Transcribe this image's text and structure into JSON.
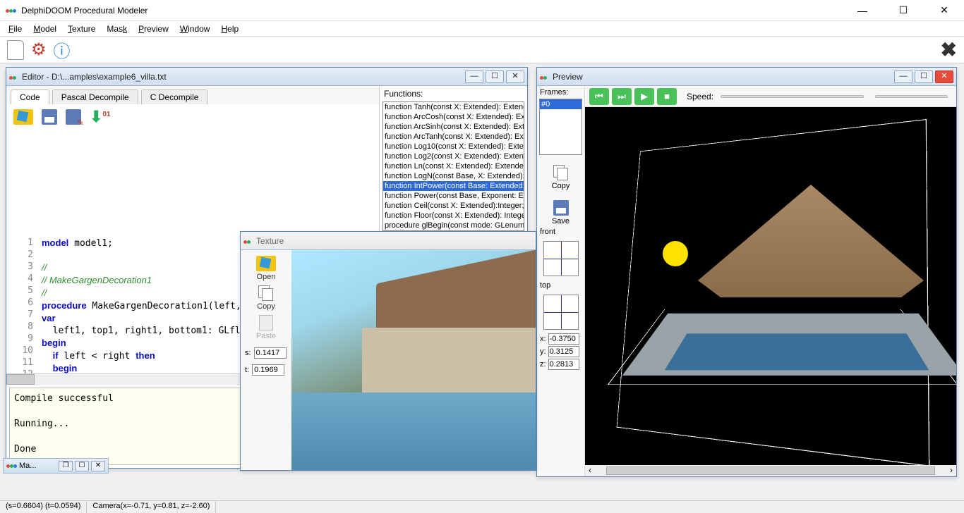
{
  "app": {
    "title": "DelphiDOOM Procedural Modeler"
  },
  "menu": {
    "file": "File",
    "model": "Model",
    "texture": "Texture",
    "mask": "Mask",
    "preview": "Preview",
    "window": "Window",
    "help": "Help"
  },
  "editor": {
    "title": "Editor - D:\\...amples\\example6_villa.txt",
    "tabs": {
      "code": "Code",
      "pascal": "Pascal Decompile",
      "cdec": "C Decompile"
    },
    "functions_label": "Functions:",
    "functions": [
      "function Tanh(const X: Extended): Extend",
      "function ArcCosh(const X: Extended): Ext",
      "function ArcSinh(const X: Extended): Exte",
      "function ArcTanh(const X: Extended): Ext",
      "function Log10(const X: Extended): Exten",
      "function Log2(const X: Extended): Extend",
      "function Ln(const X: Extended): Extended",
      "function LogN(const Base, X: Extended): E",
      "function IntPower(const Base: Extended;",
      "function Power(const Base, Exponent: Ex",
      "function Ceil(const X: Extended):Integer;",
      "function Floor(const X: Extended): Intege",
      "procedure glBegin(const mode: GLenum);"
    ],
    "func_selected_index": 8,
    "console": "Compile successful\n\nRunning...\n\nDone"
  },
  "texture": {
    "title": "Texture",
    "open": "Open",
    "copy": "Copy",
    "paste": "Paste",
    "s_label": "s:",
    "t_label": "t:",
    "s": "0.1417",
    "t": "0.1969"
  },
  "preview": {
    "title": "Preview",
    "frames_label": "Frames:",
    "frame_item": "#0",
    "copy": "Copy",
    "save": "Save",
    "front": "front",
    "top": "top",
    "speed": "Speed:",
    "x_label": "x:",
    "y_label": "y:",
    "z_label": "z:",
    "x": "-0.3750",
    "y": "0.3125",
    "z": "0.2813"
  },
  "minitask": {
    "label": "Ma..."
  },
  "status": {
    "st": "(s=0.6604) (t=0.0594)",
    "cam": "Camera(x=-0.71, y=0.81, z=-2.60)"
  }
}
